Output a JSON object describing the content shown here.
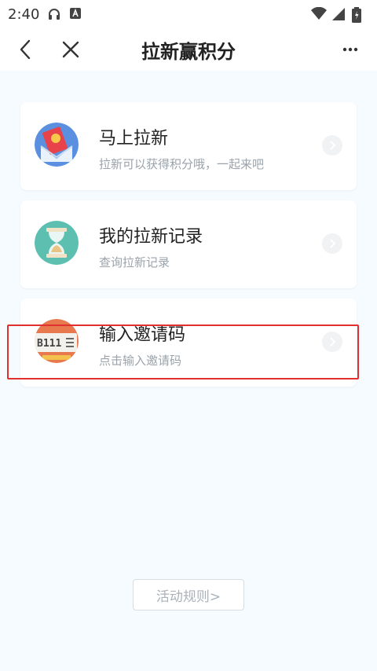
{
  "status_bar": {
    "time": "2:40"
  },
  "header": {
    "title": "拉新赢积分"
  },
  "cards": [
    {
      "title": "马上拉新",
      "subtitle": "拉新可以获得积分哦，一起来吧",
      "icon": "red-envelope-icon"
    },
    {
      "title": "我的拉新记录",
      "subtitle": "查询拉新记录",
      "icon": "hourglass-icon"
    },
    {
      "title": "输入邀请码",
      "subtitle": "点击输入邀请码",
      "icon": "invite-code-icon",
      "icon_text": "B111"
    }
  ],
  "footer": {
    "rules_label": "活动规则>"
  },
  "colors": {
    "accent_highlight": "#e0302f",
    "page_bg": "#f5fbff"
  }
}
